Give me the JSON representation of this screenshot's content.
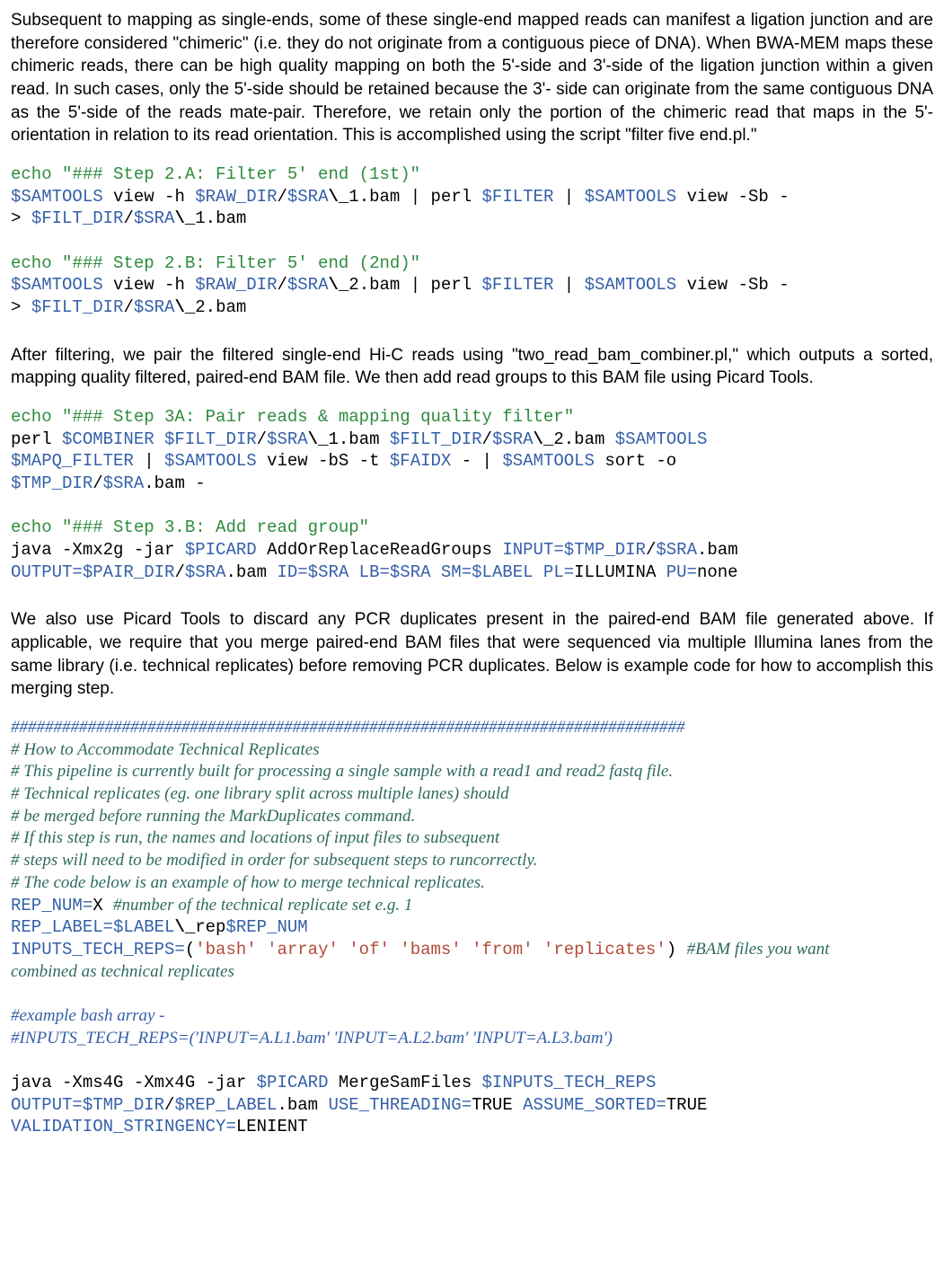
{
  "para1": "Subsequent to mapping as single-ends, some of these single-end mapped reads can manifest a ligation junction and are therefore considered \"chimeric\" (i.e. they do not originate from a contiguous piece of DNA). When BWA-MEM maps these chimeric reads, there can be high quality mapping on both the 5'-side and 3'-side of the ligation junction within a given read. In such cases, only the 5'-side should be retained because the 3'- side can originate from the same contiguous DNA as the 5'-side of the reads mate-pair. Therefore, we retain only the portion of the chimeric read that maps in the 5'-orientation in relation to its read orientation. This is accomplished using the script \"filter five end.pl.\"",
  "code1": {
    "echo2a": "echo \"### Step 2.A: Filter 5' end (1st)\"",
    "l2": {
      "a": "$SAMTOOLS",
      "b": " view -h ",
      "c": "$RAW_DIR",
      "d": "/",
      "e": "$SRA",
      "f": "\\_",
      "g": "1.bam | perl ",
      "h": "$FILTER",
      "i": " | ",
      "j": "$SAMTOOLS",
      "k": " view -Sb -"
    },
    "l3": {
      "a": "> ",
      "b": "$FILT_DIR",
      "c": "/",
      "d": "$SRA",
      "e": "\\_",
      "f": "1.bam"
    },
    "echo2b": "echo \"### Step 2.B: Filter 5' end (2nd)\"",
    "l5": {
      "a": "$SAMTOOLS",
      "b": " view -h ",
      "c": "$RAW_DIR",
      "d": "/",
      "e": "$SRA",
      "f": "\\_",
      "g": "2.bam | perl ",
      "h": "$FILTER",
      "i": " | ",
      "j": "$SAMTOOLS",
      "k": " view -Sb -"
    },
    "l6": {
      "a": "> ",
      "b": "$FILT_DIR",
      "c": "/",
      "d": "$SRA",
      "e": "\\_",
      "f": "2.bam"
    }
  },
  "para2": "After filtering, we pair the filtered single-end Hi-C reads using  \"two_read_bam_combiner.pl,\" which outputs a sorted, mapping quality filtered, paired-end BAM file. We then add read groups to this BAM file using Picard Tools.",
  "code2": {
    "echo3a": "echo \"### Step 3A: Pair reads & mapping quality filter\"",
    "l2": {
      "a": "perl ",
      "b": "$COMBINER $FILT_DIR",
      "c": "/",
      "d": "$SRA",
      "e": "\\_",
      "f": "1.bam ",
      "g": "$FILT_DIR",
      "h": "/",
      "i": "$SRA",
      "j": "\\_",
      "k": "2.bam ",
      "l": "$SAMTOOLS"
    },
    "l3": {
      "a": "$MAPQ_FILTER",
      "b": " | ",
      "c": "$SAMTOOLS",
      "d": " view -bS -t ",
      "e": "$FAIDX",
      "f": " - | ",
      "g": "$SAMTOOLS",
      "h": " sort -o"
    },
    "l4": {
      "a": "$TMP_DIR",
      "b": "/",
      "c": "$SRA",
      "d": ".bam -"
    },
    "echo3b": "echo \"### Step 3.B: Add read group\"",
    "l6": {
      "a": "java -Xmx2g -jar ",
      "b": "$PICARD",
      "c": " AddOrReplaceReadGroups ",
      "d": "INPUT=$TMP_DIR",
      "e": "/",
      "f": "$SRA",
      "g": ".bam"
    },
    "l7": {
      "a": "OUTPUT=$PAIR_DIR",
      "b": "/",
      "c": "$SRA",
      "d": ".bam ",
      "e": "ID=$SRA LB=$SRA SM=$LABEL PL=",
      "f": "ILLUMINA ",
      "g": "PU=",
      "h": "none"
    }
  },
  "para3": "We also use Picard Tools to discard any PCR duplicates present in the paired-end BAM file generated above. If applicable, we require that you merge paired-end BAM files that were sequenced via multiple Illumina lanes from the same library (i.e. technical replicates) before removing PCR duplicates. Below is example code for how to accomplish this merging step.",
  "code3": {
    "hashline": "###############################################################################",
    "c1": "# How to Accommodate Technical Replicates",
    "c2": "# This pipeline is currently built for processing a single sample with a read1 and read2 fastq file.",
    "c3": "# Technical replicates (eg. one library split across multiple lanes) should",
    "c4": "# be merged before running the MarkDuplicates command.",
    "c5": "# If this step is run, the names and locations of input files to subsequent",
    "c6": "# steps will need to be modified in order for subsequent steps to runcorrectly.",
    "c7": "# The code below is an example of how to merge technical replicates.",
    "l8": {
      "a": "REP_NUM=",
      "b": "X ",
      "c": "#number of the technical replicate set e.g. 1"
    },
    "l9": {
      "a": "REP_LABEL=$LABEL",
      "b": "\\_",
      "c": "rep",
      "d": "$REP_NUM"
    },
    "l10": {
      "a": "INPUTS_TECH_REPS=",
      "b": "(",
      "c": "'bash' 'array' 'of' 'bams' 'from' 'replicates'",
      "d": ") ",
      "e": "#BAM files you want"
    },
    "l11": "combined as technical replicates",
    "c12": "#example bash array -",
    "c13": "#INPUTS_TECH_REPS=('INPUT=A.L1.bam' 'INPUT=A.L2.bam' 'INPUT=A.L3.bam')",
    "l14": {
      "a": "java -Xms4G -Xmx4G -jar ",
      "b": "$PICARD ",
      "c": "MergeSamFiles ",
      "d": "$INPUTS_TECH_REPS"
    },
    "l15": {
      "a": "OUTPUT=$TMP_DIR",
      "b": "/",
      "c": "$REP_LABEL",
      "d": ".bam ",
      "e": "USE_THREADING=",
      "f": "TRUE ",
      "g": "ASSUME_SORTED=",
      "h": "TRUE"
    },
    "l16": {
      "a": "VALIDATION_STRINGENCY=",
      "b": "LENIENT"
    }
  }
}
